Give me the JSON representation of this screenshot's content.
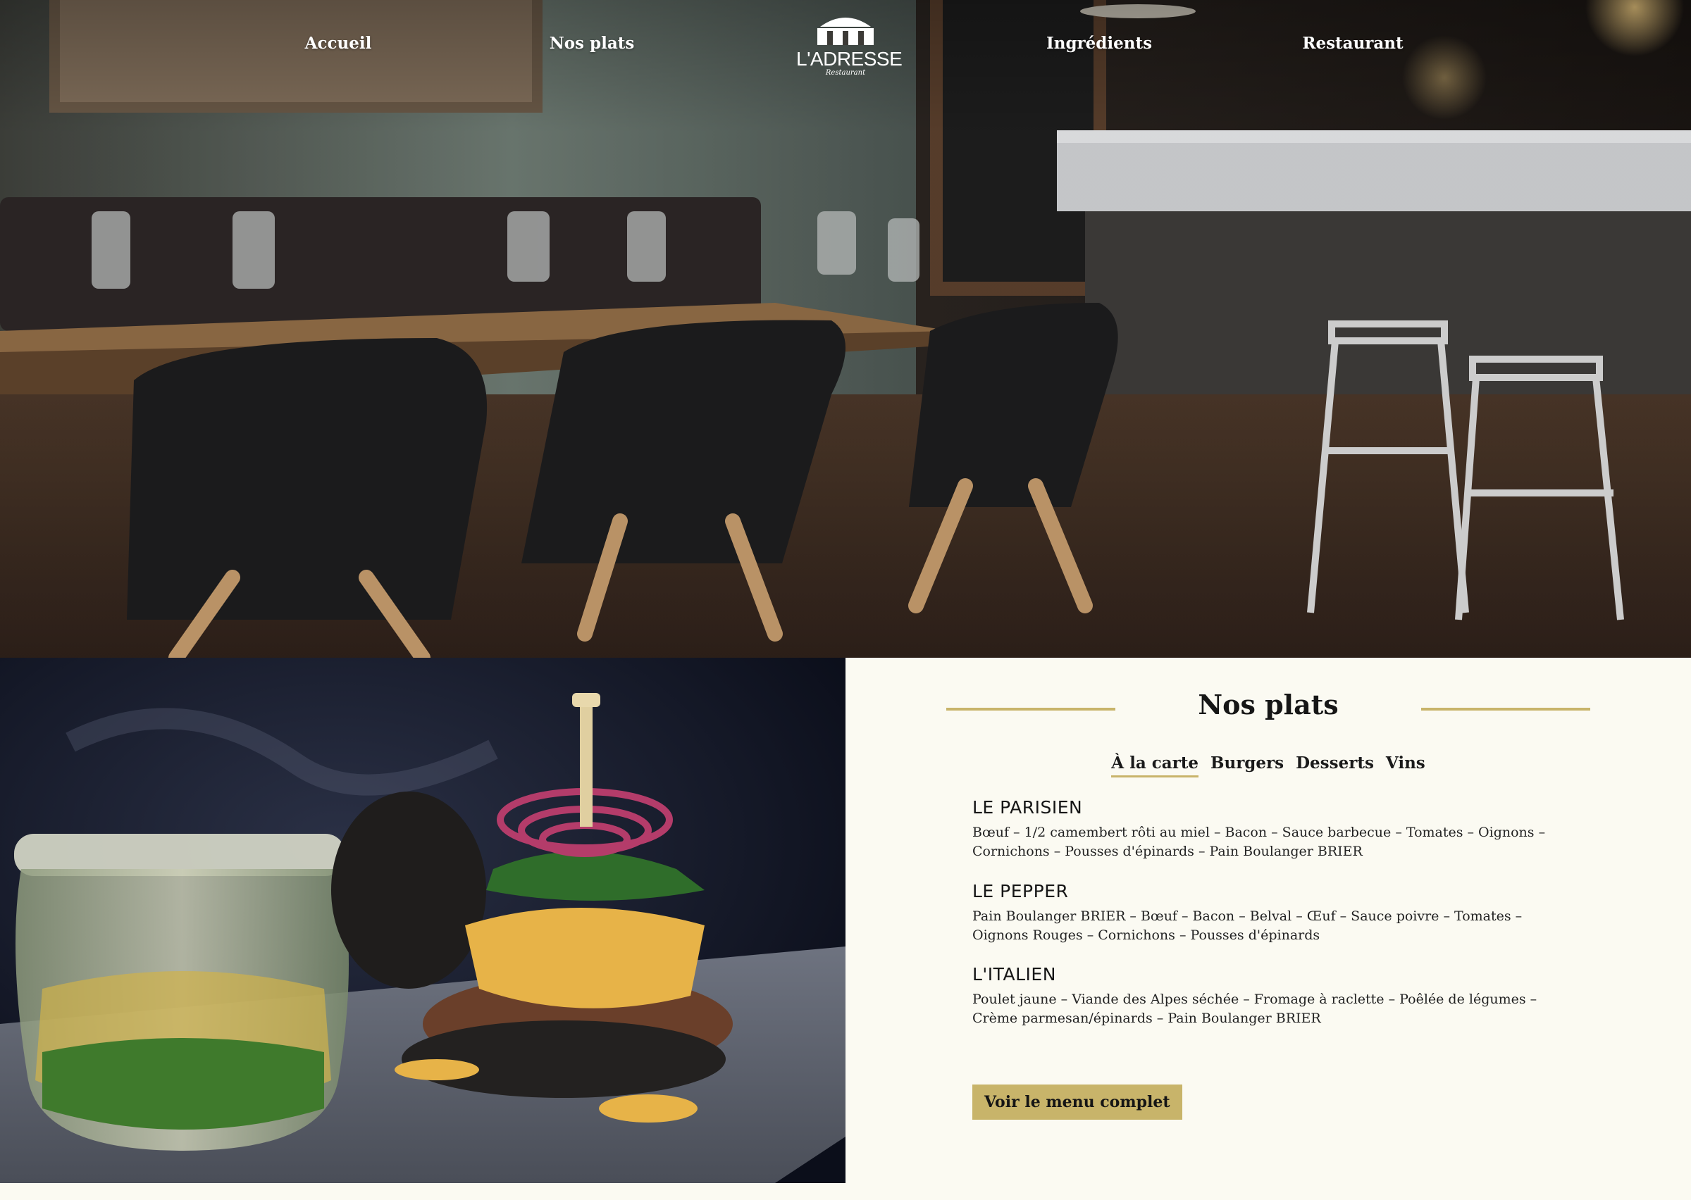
{
  "nav": {
    "links": [
      "Accueil",
      "Nos plats",
      "Ingrédients",
      "Restaurant"
    ],
    "logo_text": "L'ADRESSE",
    "logo_script": "Restaurant"
  },
  "menu": {
    "title": "Nos plats",
    "tabs": [
      "À la carte",
      "Burgers",
      "Desserts",
      "Vins"
    ],
    "active_tab": "À la carte",
    "dishes": [
      {
        "name": "LE PARISIEN",
        "description": "Bœuf – 1/2 camembert rôti au miel – Bacon – Sauce barbecue – Tomates – Oignons – Cornichons – Pousses d'épinards – Pain Boulanger BRIER"
      },
      {
        "name": "LE PEPPER",
        "description": "Pain Boulanger BRIER – Bœuf – Bacon – Belval – Œuf – Sauce poivre – Tomates – Oignons Rouges – Cornichons – Pousses d'épinards"
      },
      {
        "name": "L'ITALIEN",
        "description": "Poulet jaune – Viande des Alpes séchée – Fromage à raclette – Poêlée de légumes – Crème parmesan/épinards – Pain Boulanger BRIER"
      }
    ],
    "cta_label": "Voir le menu complet"
  },
  "colors": {
    "accent": "#c8b46a",
    "panel_background": "#fbfaf2",
    "text": "#161616"
  }
}
